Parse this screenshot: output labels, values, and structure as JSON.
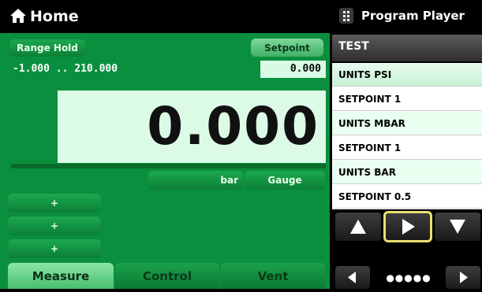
{
  "home": {
    "title": "Home"
  },
  "controls": {
    "range_hold": "Range Hold",
    "setpoint_label": "Setpoint",
    "setpoint_value": "0.000",
    "range_text": "-1.000 .. 210.000",
    "reading": "0.000",
    "unit": "bar",
    "mode": "Gauge",
    "plus_buttons": [
      "+",
      "+",
      "+"
    ]
  },
  "bottom_tabs": [
    {
      "label": "Measure",
      "active": true
    },
    {
      "label": "Control",
      "active": false
    },
    {
      "label": "Vent",
      "active": false
    }
  ],
  "program_player": {
    "title": "Program Player",
    "program_name": "TEST",
    "steps": [
      "UNITS PSI",
      "SETPOINT 1",
      "UNITS MBAR",
      "SETPOINT 1",
      "UNITS BAR",
      "SETPOINT 0.5"
    ],
    "page_dots": "●●●●●"
  },
  "colors": {
    "accent_green": "#0a8f3e",
    "display_bg": "#dcfbe7",
    "highlight": "#e8e070"
  },
  "icons": [
    "home-icon",
    "grid-icon",
    "up-arrow-icon",
    "play-icon",
    "down-arrow-icon",
    "left-arrow-icon",
    "right-arrow-icon"
  ]
}
